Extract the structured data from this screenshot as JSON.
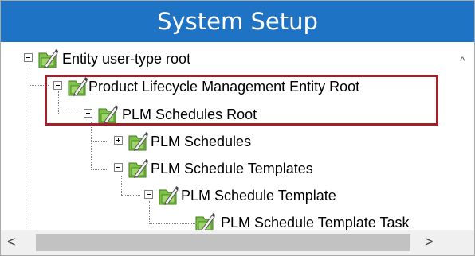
{
  "window": {
    "title": "System Setup"
  },
  "tree": {
    "nodes": [
      {
        "label": "Entity user-type root",
        "expanded": true,
        "icon": "entity-folder-icon"
      },
      {
        "label": "Product Lifecycle Management Entity Root",
        "expanded": true,
        "icon": "entity-folder-icon"
      },
      {
        "label": "PLM Schedules Root",
        "expanded": true,
        "icon": "entity-folder-icon"
      },
      {
        "label": "PLM Schedules",
        "expanded": false,
        "icon": "entity-folder-icon"
      },
      {
        "label": "PLM Schedule Templates",
        "expanded": true,
        "icon": "entity-folder-icon"
      },
      {
        "label": "PLM Schedule Template",
        "expanded": true,
        "icon": "entity-folder-icon"
      },
      {
        "label": "PLM Schedule Template Task",
        "expanded": false,
        "icon": "entity-folder-icon"
      }
    ]
  },
  "scrollbar": {
    "up_arrow": "^",
    "left_arrow": "<",
    "right_arrow": ">"
  },
  "colors": {
    "title_bar": "#1e73c4",
    "highlight_border": "#a3202a"
  }
}
